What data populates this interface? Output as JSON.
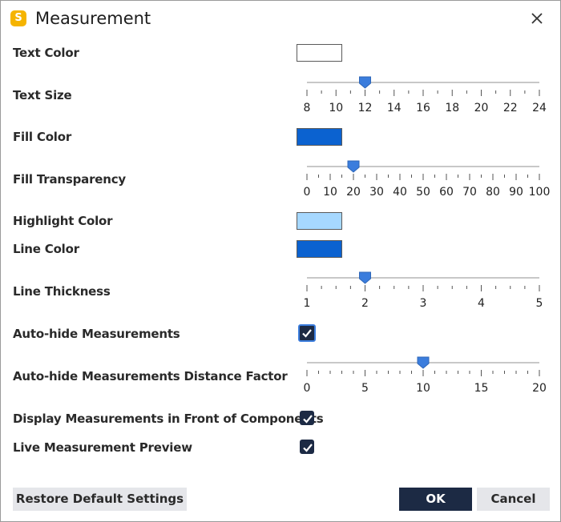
{
  "window": {
    "title": "Measurement",
    "app_icon_letter": "S",
    "close_icon": "close-icon"
  },
  "colors": {
    "text_color_swatch": "#ffffff",
    "fill_color_swatch": "#0b62d0",
    "highlight_color_swatch": "#a6d8ff",
    "line_color_swatch": "#0b62d0",
    "slider_handle": "#3b7ddd",
    "checkbox_fill": "#1c2a44",
    "primary_button": "#1c2a44"
  },
  "settings": {
    "text_color": {
      "label": "Text Color"
    },
    "text_size": {
      "label": "Text Size",
      "min": 8,
      "max": 24,
      "value": 12,
      "ticks": [
        "8",
        "10",
        "12",
        "14",
        "16",
        "18",
        "20",
        "22",
        "24"
      ],
      "minor_per_major": 2
    },
    "fill_color": {
      "label": "Fill Color"
    },
    "fill_transparency": {
      "label": "Fill Transparency",
      "min": 0,
      "max": 100,
      "value": 20,
      "ticks": [
        "0",
        "10",
        "20",
        "30",
        "40",
        "50",
        "60",
        "70",
        "80",
        "90",
        "100"
      ],
      "minor_per_major": 2
    },
    "highlight_color": {
      "label": "Highlight Color"
    },
    "line_color": {
      "label": "Line Color"
    },
    "line_thickness": {
      "label": "Line Thickness",
      "min": 1,
      "max": 5,
      "value": 2,
      "ticks": [
        "1",
        "2",
        "3",
        "4",
        "5"
      ],
      "minor_per_major": 4
    },
    "auto_hide": {
      "label": "Auto-hide Measurements",
      "checked": true
    },
    "auto_hide_distance": {
      "label": "Auto-hide Measurements Distance Factor",
      "min": 0,
      "max": 20,
      "value": 10,
      "ticks": [
        "0",
        "5",
        "10",
        "15",
        "20"
      ],
      "minor_per_major": 5
    },
    "display_in_front": {
      "label": "Display Measurements in Front of Components",
      "checked": true
    },
    "live_preview": {
      "label": "Live Measurement Preview",
      "checked": true
    }
  },
  "buttons": {
    "restore": "Restore Default Settings",
    "ok": "OK",
    "cancel": "Cancel"
  }
}
